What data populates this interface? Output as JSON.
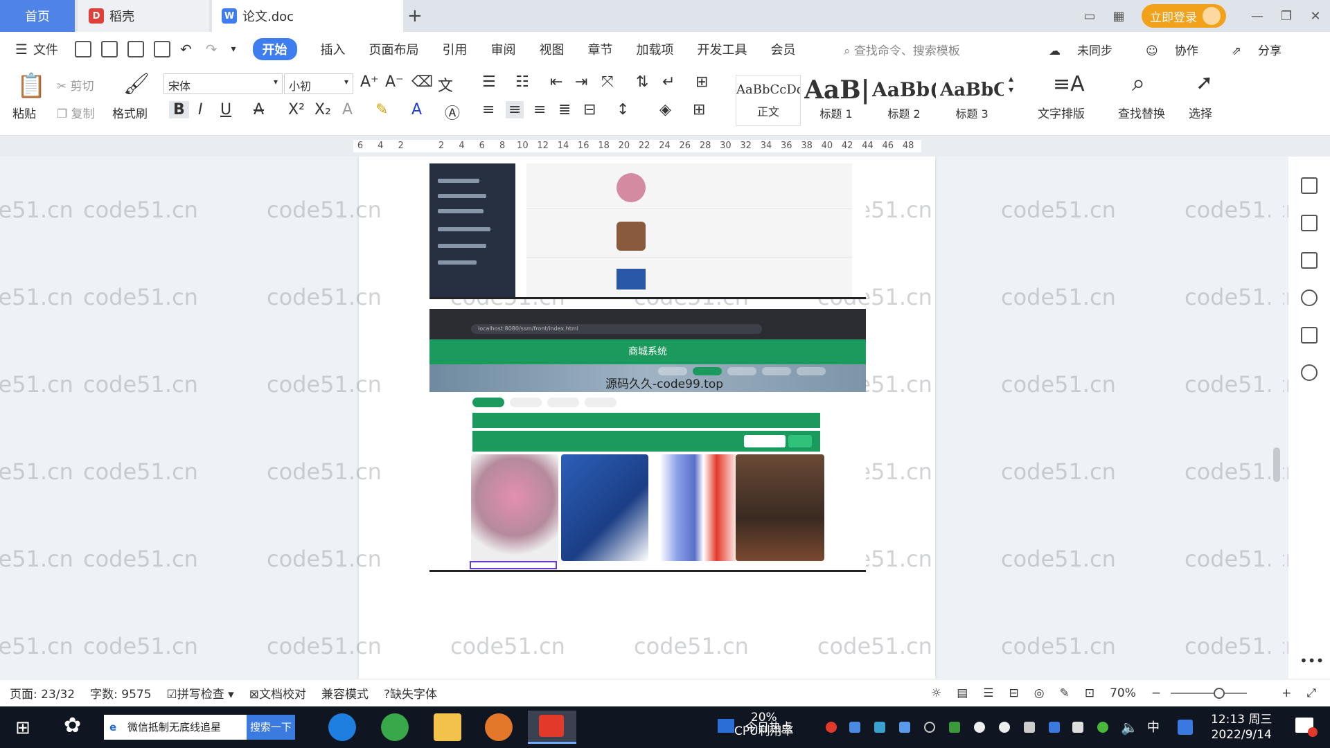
{
  "tabs": {
    "home": "首页",
    "daoke": "稻壳",
    "doc": "论文.doc",
    "add": "+"
  },
  "window": {
    "login": "立即登录",
    "minimize": "—",
    "restore": "❐",
    "close": "✕"
  },
  "menu": {
    "file": "文件",
    "items": [
      "开始",
      "插入",
      "页面布局",
      "引用",
      "审阅",
      "视图",
      "章节",
      "加载项",
      "开发工具",
      "会员"
    ],
    "search_cmd": "查找命令、搜索模板",
    "sync": "未同步",
    "collab": "协作",
    "share": "分享"
  },
  "ribbon": {
    "paste": "粘贴",
    "cut": "剪切",
    "copy": "复制",
    "format_painter": "格式刷",
    "font_name": "宋体",
    "font_size": "小初",
    "styles": [
      {
        "sample": "AaBbCcDd",
        "label": "正文"
      },
      {
        "sample": "AaB|",
        "label": "标题 1"
      },
      {
        "sample": "AaBb(",
        "label": "标题 2"
      },
      {
        "sample": "AaBbC",
        "label": "标题 3"
      }
    ],
    "text_layout": "文字排版",
    "find_replace": "查找替换",
    "select": "选择"
  },
  "ruler": {
    "ticks": [
      "6",
      "4",
      "2",
      "",
      "2",
      "4",
      "6",
      "8",
      "10",
      "12",
      "14",
      "16",
      "18",
      "20",
      "22",
      "24",
      "26",
      "28",
      "30",
      "32",
      "34",
      "36",
      "38",
      "40",
      "42",
      "44",
      "46",
      "48"
    ]
  },
  "document": {
    "watermark": "code51.cn",
    "shop_title": "商城系统",
    "overlay_text": "源码久久-code99.top",
    "url": "localhost:8080/ssm/front/index.html"
  },
  "status": {
    "page": "页面: 23/32",
    "words": "字数: 9575",
    "spell": "拼写检查",
    "proof": "文档校对",
    "compat": "兼容模式",
    "missing_font": "缺失字体",
    "zoom": "70%"
  },
  "taskbar": {
    "search_text": "微信抵制无底线追星",
    "search_btn": "搜索一下",
    "cpu_pct": "20%",
    "cpu_label": "CPU利用率",
    "hot": "今日热点",
    "ime": "中",
    "time": "12:13 周三",
    "date": "2022/9/14"
  },
  "colors": {
    "accent": "#3e7df0",
    "home_tab": "#4f83e8",
    "login": "#f2a11a",
    "shop_green": "#1a9a5c",
    "taskbar": "#101621"
  }
}
